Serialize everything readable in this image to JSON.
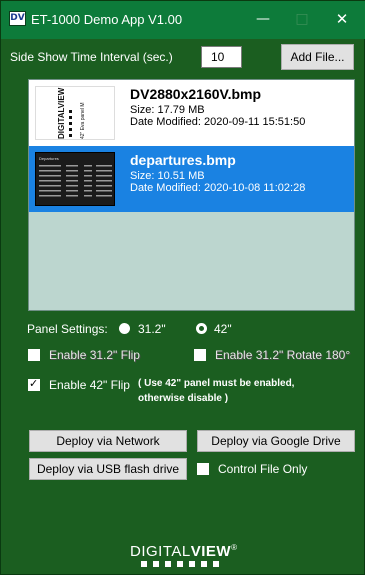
{
  "window": {
    "app_icon_text": "DV",
    "title": "ET-1000 Demo App V1.00",
    "min_symbol": "—",
    "max_symbol": "□",
    "close_symbol": "✕"
  },
  "interval": {
    "label": "Side Show Time Interval (sec.)",
    "value": "10",
    "add_file_label": "Add File..."
  },
  "files": [
    {
      "name": "DV2880x2160V.bmp",
      "size": "Size: 17.79 MB",
      "modified": "Date Modified: 2020-09-11 15:51:50",
      "thumb_text": [
        "DIGITALVIEW",
        "42\" Eva panel M"
      ],
      "selected": false
    },
    {
      "name": "departures.bmp",
      "size": "Size: 10.51 MB",
      "modified": "Date Modified: 2020-10-08 11:02:28",
      "thumb_text": [
        "Departures"
      ],
      "selected": true
    }
  ],
  "panel_settings": {
    "label": "Panel Settings:",
    "options": [
      {
        "label": "31.2\"",
        "selected": true
      },
      {
        "label": "42\"",
        "selected": false
      }
    ]
  },
  "checkboxes": {
    "flip_312": {
      "label": "Enable 31.2\" Flip",
      "checked": false
    },
    "rotate_312": {
      "label": "Enable 31.2\" Rotate 180°",
      "checked": false
    },
    "flip_42": {
      "label": "Enable 42\" Flip",
      "checked": true
    },
    "flip_42_note_line1": "( Use 42\" panel must be enabled,",
    "flip_42_note_line2": "otherwise disable )",
    "control_file_only": {
      "label": "Control File Only",
      "checked": false
    }
  },
  "buttons": {
    "deploy_network": "Deploy via Network",
    "deploy_gdrive": "Deploy via Google Drive",
    "deploy_usb": "Deploy via USB flash drive"
  },
  "logo": {
    "text_light": "DIGITAL",
    "text_bold": "VIEW",
    "mark": "®"
  },
  "colors": {
    "window_bg": "#1b5e20",
    "titlebar_bg": "#0d7b3a",
    "selection_blue": "#1a82e2",
    "list_bg": "#bcd6cf"
  }
}
